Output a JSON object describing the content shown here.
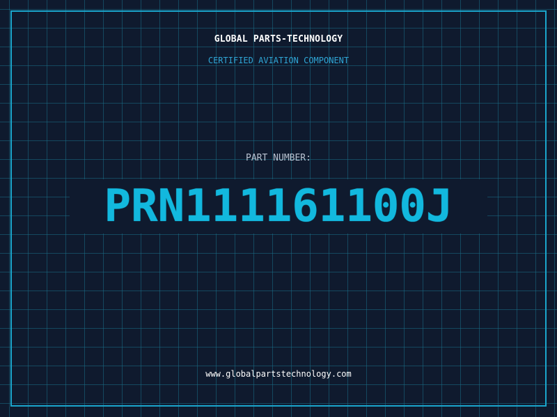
{
  "header": {
    "company": "GLOBAL PARTS-TECHNOLOGY",
    "tagline": "CERTIFIED AVIATION COMPONENT"
  },
  "part": {
    "label": "PART NUMBER:",
    "number": "PRN111161100J"
  },
  "footer": {
    "website": "www.globalpartstechnology.com"
  },
  "colors": {
    "background": "#0f1a2e",
    "grid": "#196e87",
    "frame": "#1aa6cc",
    "accent": "#12b8de",
    "tagline": "#2fa6d6",
    "label": "#b8c2d0",
    "text": "#ffffff"
  }
}
